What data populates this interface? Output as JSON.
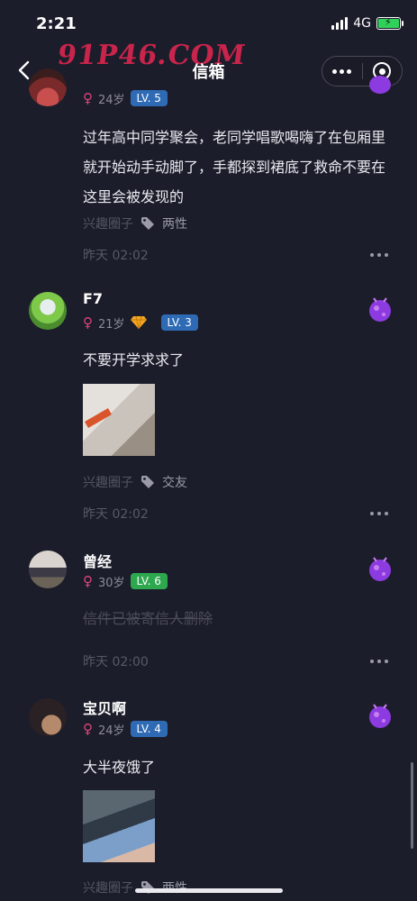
{
  "status_bar": {
    "time": "2:21",
    "network": "4G"
  },
  "header": {
    "watermark": "91P46.COM",
    "title": "信箱"
  },
  "posts": [
    {
      "age": "24岁",
      "level": "LV. 5",
      "content": "过年高中同学聚会，老同学唱歌喝嗨了在包厢里就开始动手动脚了，手都探到裙底了救命不要在这里会被发现的",
      "circle": "兴趣圈子",
      "tag": "两性",
      "time": "昨天 02:02"
    },
    {
      "name": "F7",
      "age": "21岁",
      "level": "LV. 3",
      "content": "不要开学求求了",
      "circle": "兴趣圈子",
      "tag": "交友",
      "time": "昨天 02:02"
    },
    {
      "name": "曾经",
      "age": "30岁",
      "level": "LV. 6",
      "content": "信件已被寄信人删除",
      "time": "昨天 02:00"
    },
    {
      "name": "宝贝啊",
      "age": "24岁",
      "level": "LV. 4",
      "content": "大半夜饿了",
      "circle": "兴趣圈子",
      "tag": "两性"
    }
  ],
  "colors": {
    "background": "#1c1d2b",
    "level_blue": "#2f6bb5",
    "level_green": "#2ea84f",
    "female": "#e0457a",
    "watermark": "#c9244b"
  }
}
